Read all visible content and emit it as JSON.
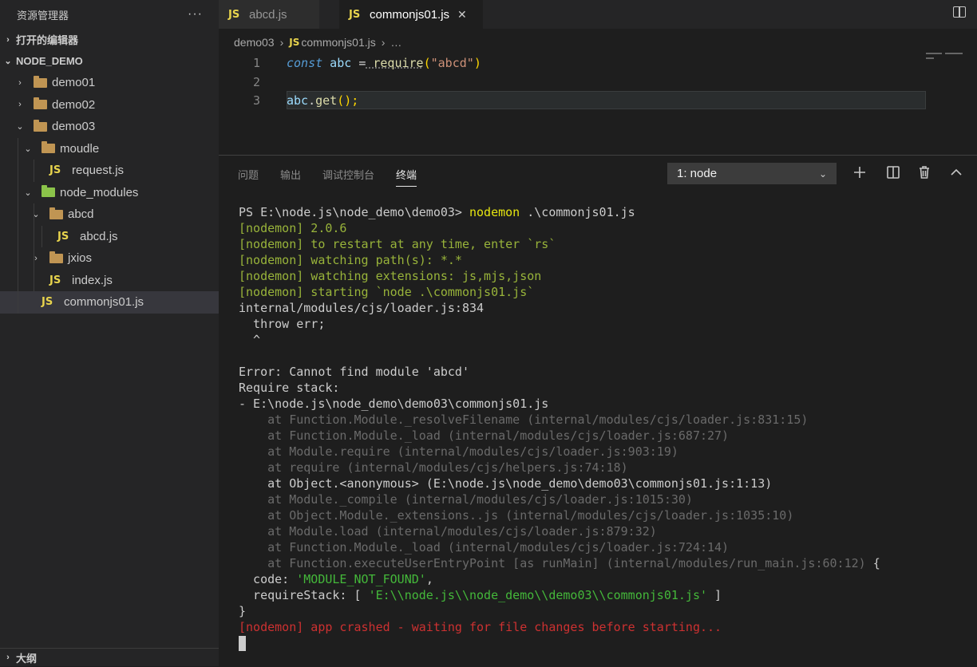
{
  "sidebar": {
    "title": "资源管理器",
    "more": "···",
    "open_editors": "打开的编辑器",
    "project": "NODE_DEMO",
    "outline": "大纲",
    "tree": [
      {
        "label": "demo01",
        "type": "folder"
      },
      {
        "label": "demo02",
        "type": "folder"
      },
      {
        "label": "demo03",
        "type": "folder"
      },
      {
        "label": "moudle",
        "type": "folder"
      },
      {
        "label": "request.js",
        "type": "js"
      },
      {
        "label": "node_modules",
        "type": "folder"
      },
      {
        "label": "abcd",
        "type": "folder"
      },
      {
        "label": "abcd.js",
        "type": "js"
      },
      {
        "label": "jxios",
        "type": "folder"
      },
      {
        "label": "index.js",
        "type": "js"
      },
      {
        "label": "commonjs01.js",
        "type": "js",
        "selected": true
      }
    ],
    "js_badge": "JS"
  },
  "tabs": [
    {
      "label": "abcd.js",
      "active": false
    },
    {
      "label": "commonjs01.js",
      "active": true
    }
  ],
  "tab_close": "✕",
  "breadcrumb": {
    "folder": "demo03",
    "file": "commonjs01.js",
    "rest": "…",
    "sep": "›"
  },
  "code": {
    "line_numbers": [
      "1",
      "2",
      "3"
    ],
    "line1": {
      "kw": "const",
      "var": " abc ",
      "op": "=",
      "fn": " require",
      "p1": "(",
      "str": "\"abcd\"",
      "p2": ")"
    },
    "line3": {
      "var": "abc",
      "op": ".",
      "fn": "get",
      "p": "();"
    }
  },
  "panel": {
    "tabs": [
      "问题",
      "输出",
      "调试控制台",
      "终端"
    ],
    "active_tab": "终端",
    "terminal_select": "1: node",
    "actions": [
      "plus-icon",
      "split-icon",
      "trash-icon",
      "chevron-up-icon"
    ]
  },
  "terminal": {
    "prompt": "PS E:\\node.js\\node_demo\\demo03> ",
    "command": "nodemon",
    "command_arg": " .\\commonjs01.js",
    "nodemon_lines": [
      "[nodemon] 2.0.6",
      "[nodemon] to restart at any time, enter `rs`",
      "[nodemon] watching path(s): *.*",
      "[nodemon] watching extensions: js,mjs,json",
      "[nodemon] starting `node .\\commonjs01.js`"
    ],
    "error_header": [
      "internal/modules/cjs/loader.js:834",
      "  throw err;",
      "  ^",
      "",
      "Error: Cannot find module 'abcd'",
      "Require stack:",
      "- E:\\node.js\\node_demo\\demo03\\commonjs01.js"
    ],
    "stack": [
      {
        "text": "    at Function.Module._resolveFilename (internal/modules/cjs/loader.js:831:15)",
        "dim": true
      },
      {
        "text": "    at Function.Module._load (internal/modules/cjs/loader.js:687:27)",
        "dim": true
      },
      {
        "text": "    at Module.require (internal/modules/cjs/loader.js:903:19)",
        "dim": true
      },
      {
        "text": "    at require (internal/modules/cjs/helpers.js:74:18)",
        "dim": true
      },
      {
        "text": "    at Object.<anonymous> (E:\\node.js\\node_demo\\demo03\\commonjs01.js:1:13)",
        "dim": false
      },
      {
        "text": "    at Module._compile (internal/modules/cjs/loader.js:1015:30)",
        "dim": true
      },
      {
        "text": "    at Object.Module._extensions..js (internal/modules/cjs/loader.js:1035:10)",
        "dim": true
      },
      {
        "text": "    at Module.load (internal/modules/cjs/loader.js:879:32)",
        "dim": true
      },
      {
        "text": "    at Function.Module._load (internal/modules/cjs/loader.js:724:14)",
        "dim": true
      },
      {
        "text": "    at Function.executeUserEntryPoint [as runMain] (internal/modules/run_main.js:60:12)",
        "dim": true,
        "suffix": " {"
      }
    ],
    "code_key": "  code: ",
    "code_val": "'MODULE_NOT_FOUND'",
    "code_comma": ",",
    "rs_key": "  requireStack: [ ",
    "rs_val": "'E:\\\\node.js\\\\node_demo\\\\demo03\\\\commonjs01.js'",
    "rs_end": " ]",
    "close_brace": "}",
    "crash": "[nodemon] app crashed - waiting for file changes before starting..."
  }
}
